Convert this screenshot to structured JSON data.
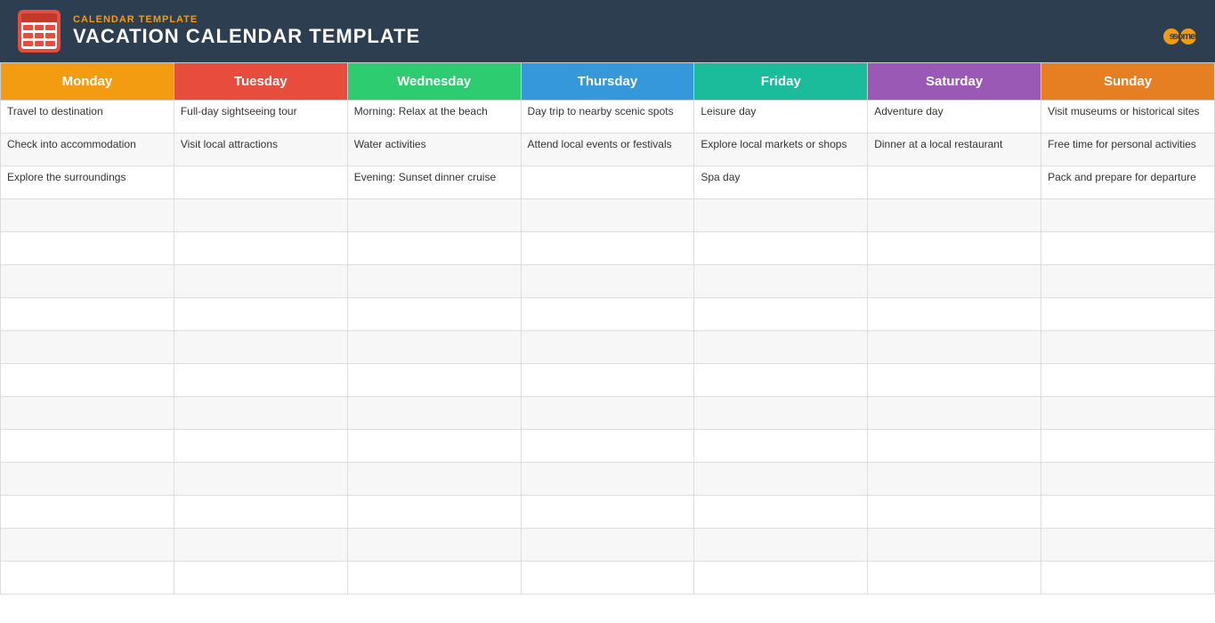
{
  "header": {
    "subtitle": "CALENDAR TEMPLATE",
    "title": "VACATION CALENDAR TEMPLATE",
    "logo_text": "someka",
    "logo_circle": "s"
  },
  "days": [
    {
      "label": "Monday",
      "class": "th-monday"
    },
    {
      "label": "Tuesday",
      "class": "th-tuesday"
    },
    {
      "label": "Wednesday",
      "class": "th-wednesday"
    },
    {
      "label": "Thursday",
      "class": "th-thursday"
    },
    {
      "label": "Friday",
      "class": "th-friday"
    },
    {
      "label": "Saturday",
      "class": "th-saturday"
    },
    {
      "label": "Sunday",
      "class": "th-sunday"
    }
  ],
  "rows": [
    [
      "Travel to destination",
      "Full-day sightseeing tour",
      "Morning: Relax at the beach",
      "Day trip to nearby scenic spots",
      "Leisure day",
      "Adventure day",
      "Visit museums or historical sites"
    ],
    [
      "Check into accommodation",
      "Visit local attractions",
      "Water activities",
      "Attend local events or festivals",
      "Explore local markets or shops",
      "Dinner at a local restaurant",
      "Free time for personal activities"
    ],
    [
      "Explore the surroundings",
      "",
      "Evening: Sunset dinner cruise",
      "",
      "Spa day",
      "",
      "Pack and prepare for departure"
    ],
    [
      "",
      "",
      "",
      "",
      "",
      "",
      ""
    ],
    [
      "",
      "",
      "",
      "",
      "",
      "",
      ""
    ],
    [
      "",
      "",
      "",
      "",
      "",
      "",
      ""
    ],
    [
      "",
      "",
      "",
      "",
      "",
      "",
      ""
    ],
    [
      "",
      "",
      "",
      "",
      "",
      "",
      ""
    ],
    [
      "",
      "",
      "",
      "",
      "",
      "",
      ""
    ],
    [
      "",
      "",
      "",
      "",
      "",
      "",
      ""
    ],
    [
      "",
      "",
      "",
      "",
      "",
      "",
      ""
    ],
    [
      "",
      "",
      "",
      "",
      "",
      "",
      ""
    ],
    [
      "",
      "",
      "",
      "",
      "",
      "",
      ""
    ],
    [
      "",
      "",
      "",
      "",
      "",
      "",
      ""
    ],
    [
      "",
      "",
      "",
      "",
      "",
      "",
      ""
    ]
  ]
}
